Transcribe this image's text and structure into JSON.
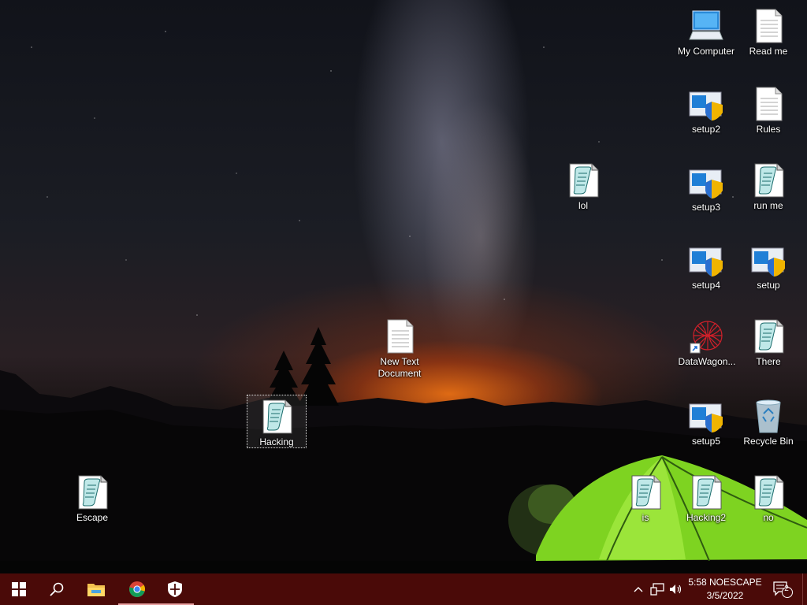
{
  "desktop": {
    "icons": [
      {
        "label": "My Computer",
        "type": "computer-icon"
      },
      {
        "label": "Read me",
        "type": "text-file-icon"
      },
      {
        "label": "setup2",
        "type": "installer-icon"
      },
      {
        "label": "Rules",
        "type": "text-file-icon"
      },
      {
        "label": "lol",
        "type": "script-icon"
      },
      {
        "label": "setup3",
        "type": "installer-icon"
      },
      {
        "label": "run me",
        "type": "script-icon"
      },
      {
        "label": "setup4",
        "type": "installer-icon"
      },
      {
        "label": "setup",
        "type": "installer-icon"
      },
      {
        "label": "New Text Document",
        "type": "text-file-icon"
      },
      {
        "label": "DataWagon...",
        "type": "shortcut-icon"
      },
      {
        "label": "There",
        "type": "script-icon"
      },
      {
        "label": "Hacking",
        "type": "script-icon"
      },
      {
        "label": "setup5",
        "type": "installer-icon"
      },
      {
        "label": "Recycle Bin",
        "type": "recycle-bin-icon"
      },
      {
        "label": "Escape",
        "type": "script-icon"
      },
      {
        "label": "is",
        "type": "script-icon"
      },
      {
        "label": "Hacking2",
        "type": "script-icon"
      },
      {
        "label": "no",
        "type": "script-icon"
      }
    ]
  },
  "taskbar": {
    "start": "windows-start-icon",
    "search": "search-icon",
    "pinned": [
      "file-explorer-icon",
      "chrome-icon",
      "security-shield-icon"
    ],
    "tray": [
      "chevron-up-icon",
      "network-icon",
      "volume-icon"
    ],
    "clock": {
      "time": "5:58 NOESCAPE",
      "date": "3/5/2022"
    },
    "notifications": {
      "count": "2"
    }
  },
  "colors": {
    "taskbar": "#4a0a08",
    "tent": "#7ed321",
    "accent": "#e8a0a0"
  }
}
